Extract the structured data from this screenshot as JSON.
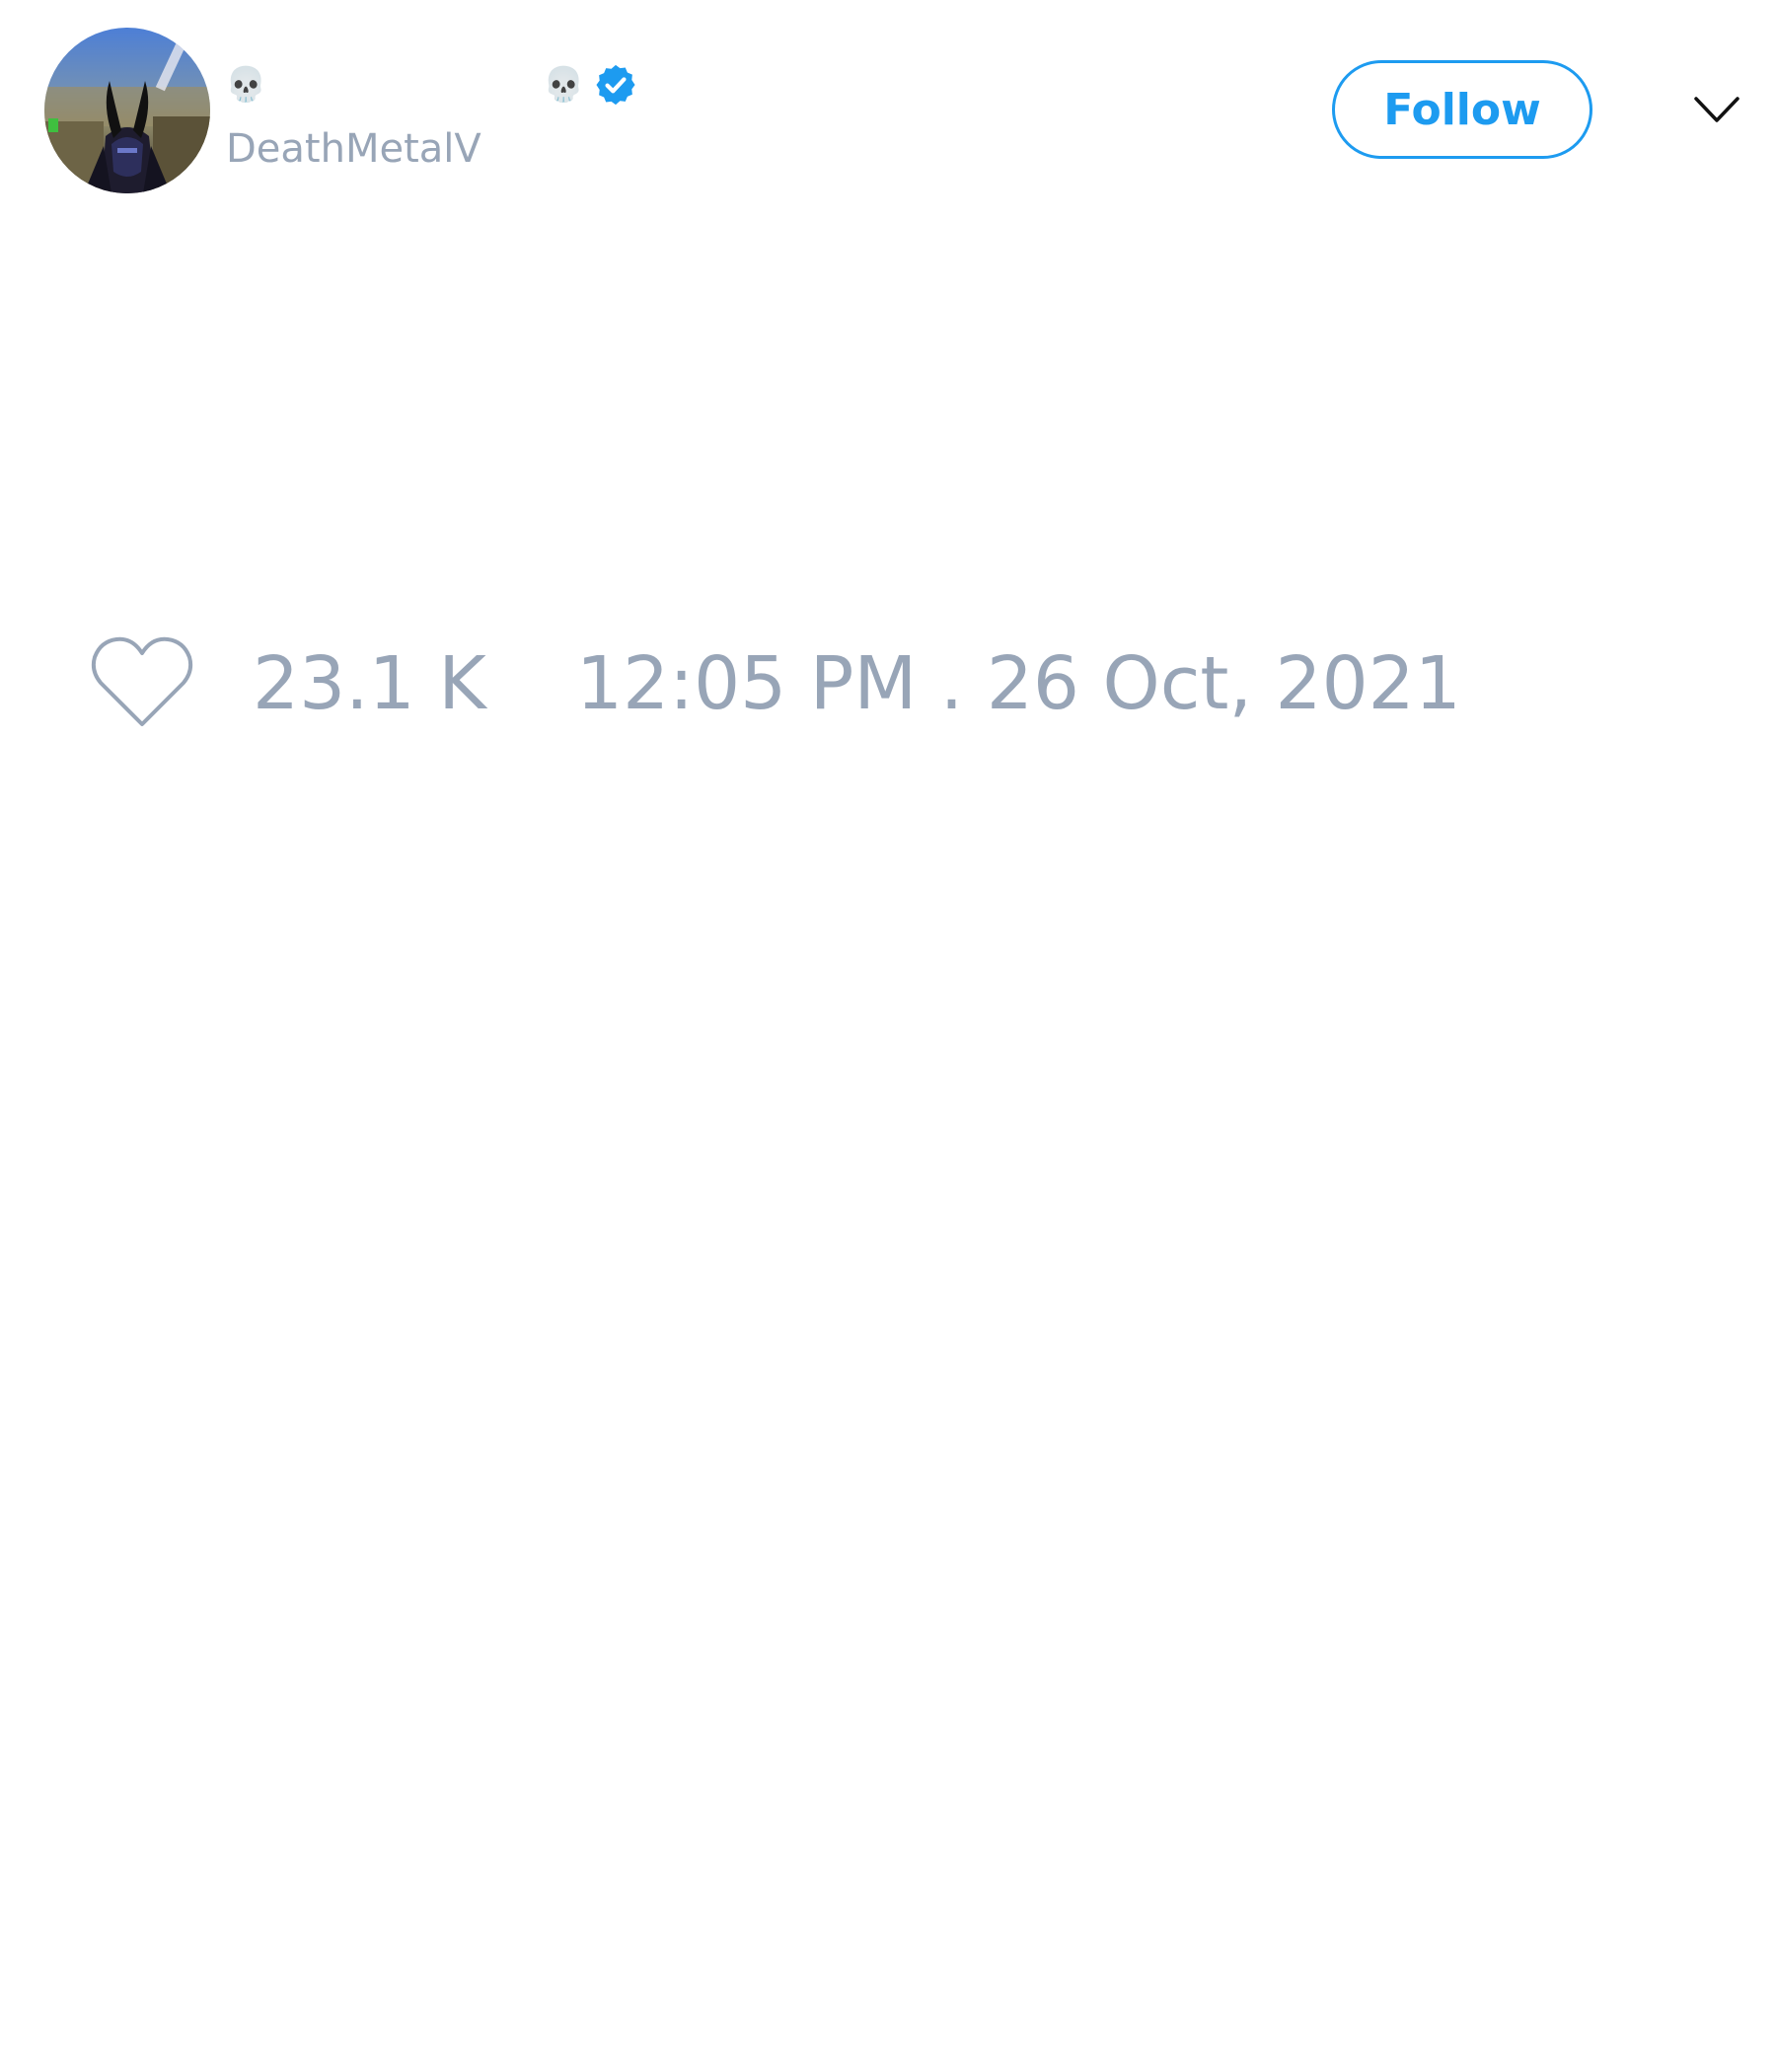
{
  "author": {
    "display_name_prefix": "💀",
    "display_name_suffix": "💀",
    "handle": "DeathMetalV",
    "verified_icon": "verified-badge-icon",
    "verified_color": "#1d9bf0",
    "avatar_icon": "horned-figure-avatar"
  },
  "header": {
    "follow_label": "Follow",
    "menu_icon": "chevron-down-icon"
  },
  "footer": {
    "like_icon": "heart-outline-icon",
    "like_count": "23.1 K",
    "timestamp": "12:05 PM . 26 Oct, 2021"
  },
  "colors": {
    "accent": "#1d9bf0",
    "muted_text": "#98a5b7",
    "background": "#ffffff"
  }
}
